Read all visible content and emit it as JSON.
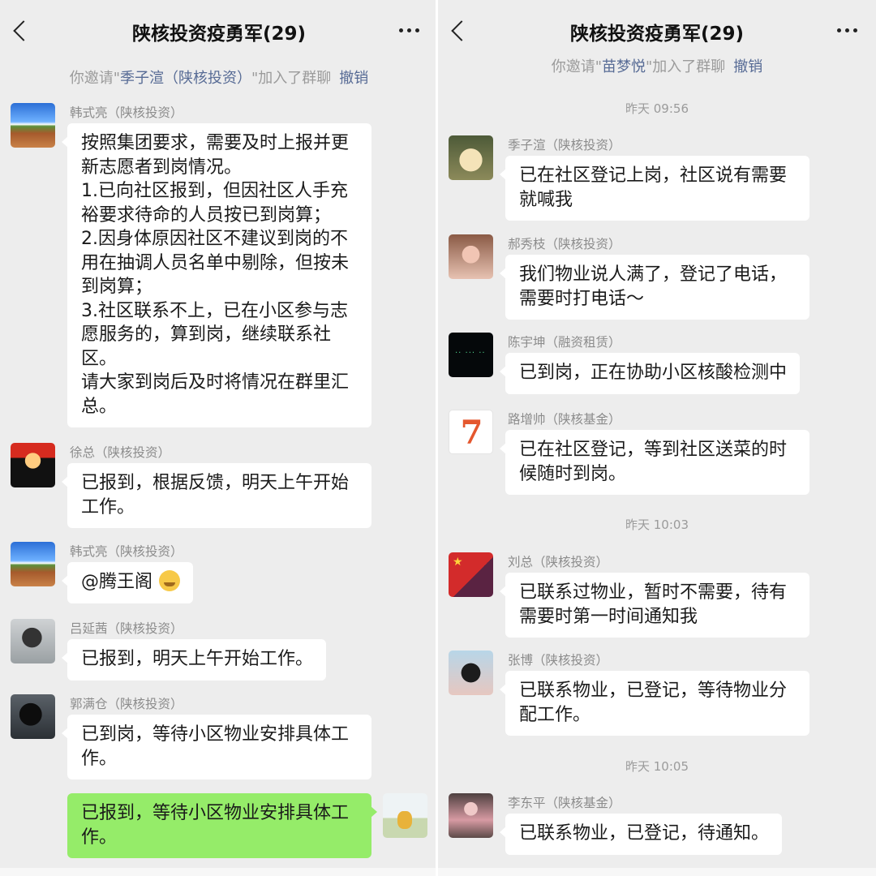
{
  "left": {
    "title": "陕核投资疫勇军(29)",
    "system": {
      "prefix": "你邀请\"",
      "name": "季子渲（陕核投资）",
      "suffix": "\"加入了群聊",
      "undo": "撤销"
    },
    "messages": [
      {
        "sender": "韩式亮（陕核投资）",
        "avatar": "landscape-avatar",
        "text": "按照集团要求，需要及时上报并更\n新志愿者到岗情况。\n1.已向社区报到，但因社区人手充\n裕要求待命的人员按已到岗算；\n2.因身体原因社区不建议到岗的不\n用在抽调人员名单中剔除，但按未\n到岗算；\n3.社区联系不上，已在小区参与志\n愿服务的，算到岗，继续联系社\n区。\n请大家到岗后及时将情况在群里汇\n总。"
      },
      {
        "sender": "徐总（陕核投资）",
        "avatar": "mario-avatar",
        "text": "已报到，根据反馈，明天上午开始\n工作。"
      },
      {
        "sender": "韩式亮（陕核投资）",
        "avatar": "landscape-avatar",
        "text": "@腾王阁"
      },
      {
        "sender": "吕延茜（陕核投资）",
        "avatar": "man-avatar",
        "text": "已报到，明天上午开始工作。"
      },
      {
        "sender": "郭满仓（陕核投资）",
        "avatar": "silhouette-avatar",
        "text": "已到岗，等待小区物业安排具体工\n作。"
      },
      {
        "sender": "",
        "avatar": "prince-avatar",
        "text": "已报到，等待小区物业安排具体工\n作。"
      }
    ]
  },
  "right": {
    "title": "陕核投资疫勇军(29)",
    "system": {
      "prefix": "你邀请\"",
      "name": "苗梦悦",
      "suffix": "\"加入了群聊",
      "undo": "撤销"
    },
    "times": [
      "昨天 09:56",
      "昨天 10:03",
      "昨天 10:05"
    ],
    "messages": [
      {
        "sender": "季子渲（陕核投资）",
        "avatar": "cat-avatar",
        "text": "已在社区登记上岗，社区说有需要\n就喊我"
      },
      {
        "sender": "郝秀枝（陕核投资）",
        "avatar": "girl-avatar",
        "text": "我们物业说人满了，登记了电话，\n需要时打电话～"
      },
      {
        "sender": "陈宇坤（融资租赁）",
        "avatar": "dark-avatar",
        "text": "已到岗，正在协助小区核酸检测中"
      },
      {
        "sender": "路增帅（陕核基金）",
        "avatar": "seven-avatar",
        "avatar_text": "7",
        "text": "已在社区登记，等到社区送菜的时\n候随时到岗。"
      },
      {
        "sender": "刘总（陕核投资）",
        "avatar": "flag-avatar",
        "text": "已联系过物业，暂时不需要，待有\n需要时第一时间通知我"
      },
      {
        "sender": "张博（陕核投资）",
        "avatar": "mask-avatar",
        "text": "已联系物业，已登记，等待物业分\n配工作。"
      },
      {
        "sender": "李东平（陕核基金）",
        "avatar": "dancer-avatar",
        "text": "已联系物业，已登记，待通知。"
      }
    ]
  },
  "colors": {
    "background": "#ededed",
    "bubble": "#ffffff",
    "self_bubble": "#95ec69",
    "link": "#576b95",
    "meta": "#8c8c8c"
  }
}
